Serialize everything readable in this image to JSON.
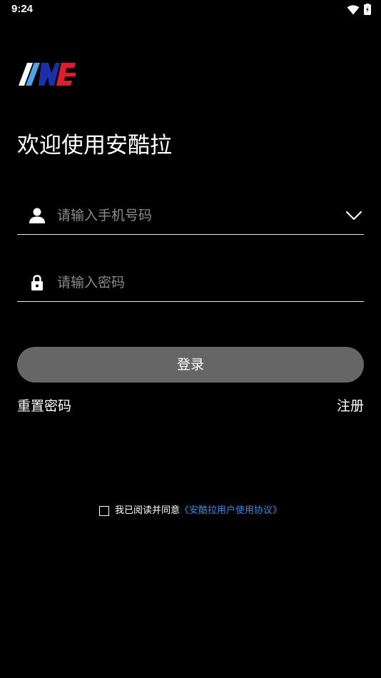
{
  "status_bar": {
    "time": "9:24"
  },
  "welcome": {
    "title": "欢迎使用安酷拉"
  },
  "phone_field": {
    "placeholder": "请输入手机号码",
    "value": ""
  },
  "password_field": {
    "placeholder": "请输入密码",
    "value": ""
  },
  "login_button": {
    "label": "登录"
  },
  "links": {
    "reset_password": "重置密码",
    "register": "注册"
  },
  "agreement": {
    "checked": false,
    "text": "我已阅读并同意",
    "link": "《安酷拉用户使用协议》"
  },
  "colors": {
    "background": "#000000",
    "button": "#666666",
    "link": "#2b8ef0",
    "logo_light_blue": "#4fa3e8",
    "logo_dark_blue": "#1d2fa8",
    "logo_red": "#e01e2b"
  },
  "icons": {
    "logo": "brand-logo",
    "user": "user-icon",
    "lock": "lock-icon",
    "dropdown": "chevron-down-icon",
    "wifi": "wifi-icon",
    "battery": "battery-charging-icon"
  }
}
